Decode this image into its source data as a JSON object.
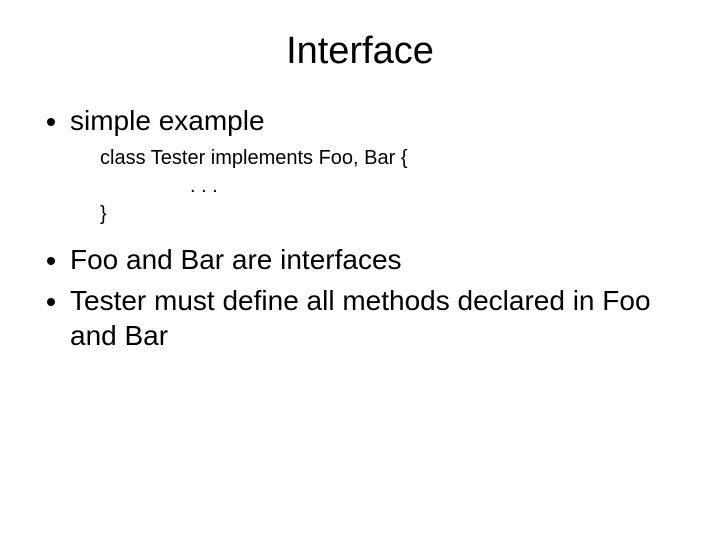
{
  "title": "Interface",
  "bullets": {
    "b1": "simple example",
    "b2": "Foo and Bar are interfaces",
    "b3": "Tester must define all methods declared in Foo and Bar"
  },
  "code": {
    "line1": "class Tester implements Foo, Bar {",
    "line2": ". . .",
    "line3": "}"
  }
}
